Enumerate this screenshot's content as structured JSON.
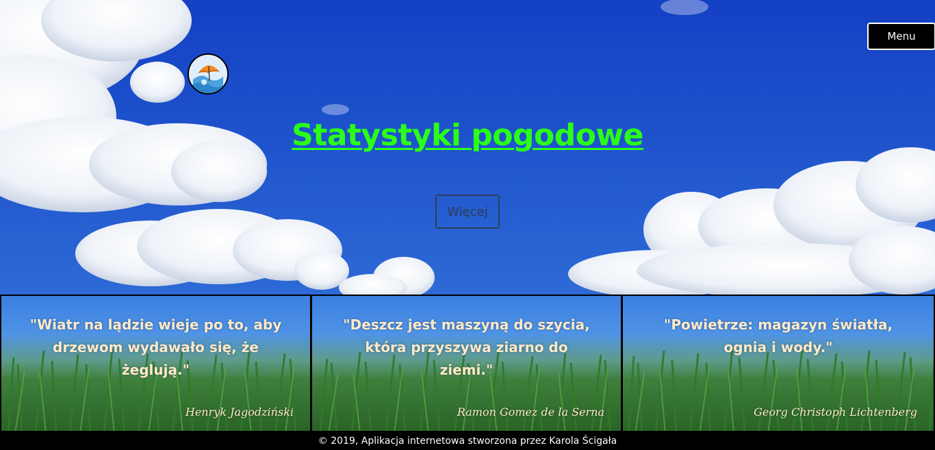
{
  "header": {
    "menu_label": "Menu",
    "title": "Statystyki pogodowe",
    "more_label": "Więcej"
  },
  "quotes": [
    {
      "text": "\"Wiatr na lądzie wieje po to, aby drzewom wydawało się, że żeglują.\"",
      "author": "Henryk Jagodziński"
    },
    {
      "text": "\"Deszcz jest maszyną do szycia, która przyszywa ziarno do ziemi.\"",
      "author": "Ramon Gomez de la Serna"
    },
    {
      "text": "\"Powietrze: magazyn światła, ognia i wody.\"",
      "author": "Georg Christoph Lichtenberg"
    }
  ],
  "footer": {
    "text": "© 2019, Aplikacja internetowa stworzona przez Karola Ścigała"
  },
  "colors": {
    "title": "#2bff17",
    "quote_text": "#ffe9c8",
    "sky": "#1e52cc",
    "footer_bg": "#000000"
  },
  "icons": {
    "logo": "umbrella-logo-icon"
  }
}
